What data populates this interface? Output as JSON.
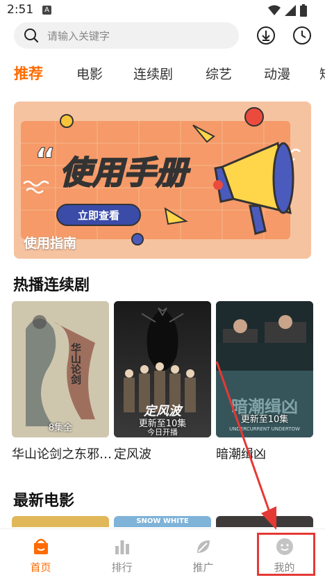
{
  "status": {
    "time": "2:51",
    "a_badge": "A"
  },
  "search": {
    "placeholder": "请输入关键字"
  },
  "tabs": [
    {
      "label": "推荐",
      "active": true
    },
    {
      "label": "电影"
    },
    {
      "label": "连续剧"
    },
    {
      "label": "综艺"
    },
    {
      "label": "动漫"
    },
    {
      "label": "短"
    }
  ],
  "banner": {
    "caption": "使用指南",
    "headline": "使用手册",
    "button": "立即查看",
    "quote_mark": "“"
  },
  "hot_series": {
    "title": "热播连续剧",
    "items": [
      {
        "title": "华山论剑之东邪…",
        "badge": "8集全",
        "poster_text": "华山论剑"
      },
      {
        "title": "定风波",
        "badge": "更新至10集",
        "badge_sub": "今日开播",
        "poster_text": "定风波"
      },
      {
        "title": "暗潮缉凶",
        "badge": "更新至10集",
        "poster_text": "暗潮缉凶",
        "poster_sub": "UNDERCURRENT UNDERTOW"
      }
    ]
  },
  "new_movies": {
    "title": "最新电影",
    "poster2_text": "SNOW WHITE"
  },
  "bottom_nav": [
    {
      "label": "首页",
      "icon": "home-icon",
      "active": true
    },
    {
      "label": "排行",
      "icon": "ranking-icon"
    },
    {
      "label": "推广",
      "icon": "promote-icon"
    },
    {
      "label": "我的",
      "icon": "profile-icon"
    }
  ],
  "colors": {
    "accent": "#ff6b00",
    "annotation": "#e53935"
  }
}
